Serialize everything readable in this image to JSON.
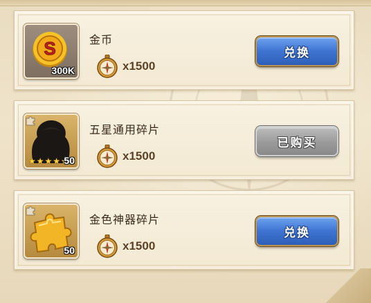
{
  "shop": {
    "items": [
      {
        "name": "金币",
        "icon": "gold-coin-icon",
        "quantity": "300K",
        "price": "x1500",
        "price_icon": "compass-icon",
        "button_label": "兑换",
        "button_state": "available"
      },
      {
        "name": "五星通用碎片",
        "icon": "hero-silhouette-shard-icon",
        "quantity": "50",
        "stars": 5,
        "price": "x1500",
        "price_icon": "compass-icon",
        "button_label": "已购买",
        "button_state": "purchased"
      },
      {
        "name": "金色神器碎片",
        "icon": "gold-puzzle-piece-icon",
        "quantity": "50",
        "price": "x1500",
        "price_icon": "compass-icon",
        "button_label": "兑换",
        "button_state": "available"
      }
    ]
  },
  "colors": {
    "background": "#efe4cd",
    "card": "#f6eedb",
    "button_blue": "#3e74d2",
    "button_gray": "#9a9a9a",
    "text_dark": "#3a2b1a"
  }
}
